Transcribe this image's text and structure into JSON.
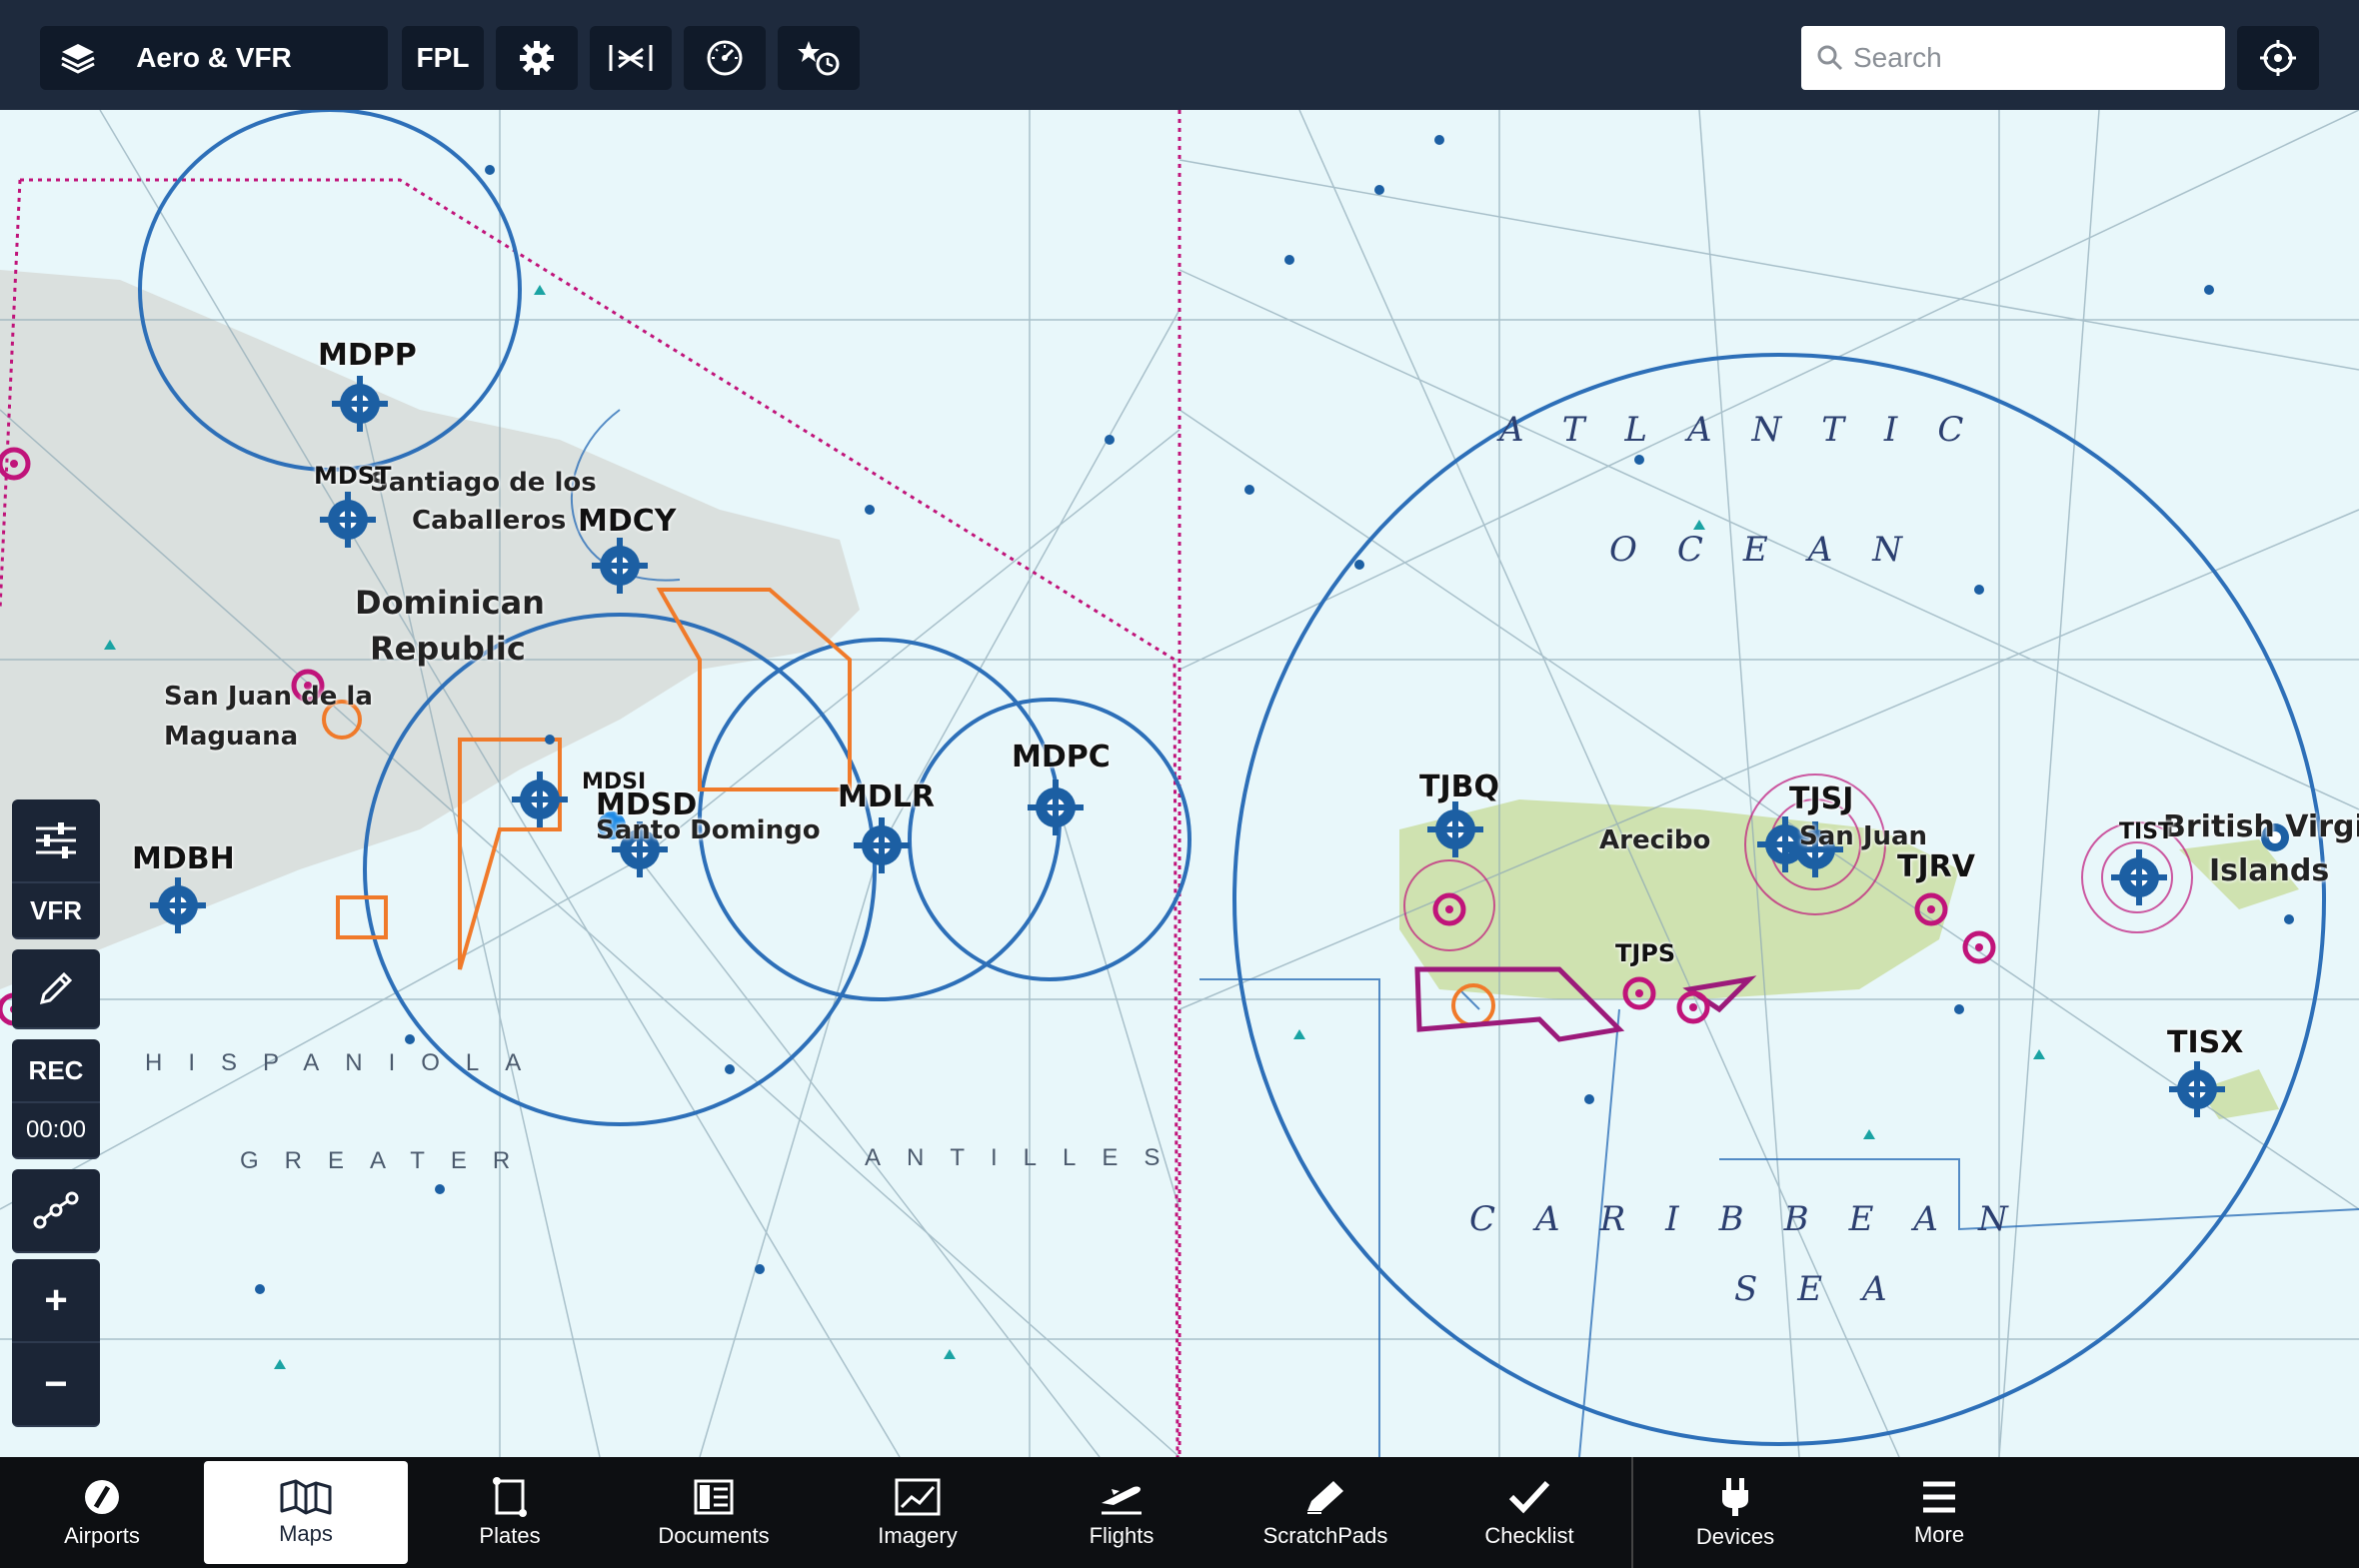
{
  "toolbar": {
    "layers_label": "Aero & VFR",
    "fpl_label": "FPL",
    "search_placeholder": "Search"
  },
  "map": {
    "airports": [
      "MDPP",
      "MDST",
      "MDCY",
      "MDSD",
      "MDSI",
      "MDLR",
      "MDPC",
      "MDBH",
      "TJBQ",
      "TJSJ",
      "TJRV",
      "TJPS",
      "TIST",
      "TISX"
    ],
    "places": {
      "dominican_1": "Dominican",
      "dominican_2": "Republic",
      "santiago_1": "Santiago de los",
      "santiago_2": "Caballeros",
      "sanjuan_mag_1": "San Juan de la",
      "sanjuan_mag_2": "Maguana",
      "santo_domingo": "Santo Domingo",
      "arecibo": "Arecibo",
      "san_juan": "San Juan",
      "bvi_1": "British Virgin",
      "bvi_2": "Islands"
    },
    "ocean": {
      "atlantic": "ATLANTIC",
      "ocean": "OCEAN",
      "caribbean": "CARIBBEAN",
      "sea": "SEA",
      "hispaniola": "HISPANIOLA",
      "greater": "GREATER",
      "antilles": "ANTILLES"
    }
  },
  "sidebar": {
    "vfr_label": "VFR",
    "rec_label": "REC",
    "timer": "00:00",
    "zoom_in": "+",
    "zoom_out": "−"
  },
  "tabs": [
    {
      "label": "Airports",
      "icon": "compass-icon"
    },
    {
      "label": "Maps",
      "icon": "map-icon",
      "selected": true
    },
    {
      "label": "Plates",
      "icon": "plate-icon"
    },
    {
      "label": "Documents",
      "icon": "documents-icon"
    },
    {
      "label": "Imagery",
      "icon": "imagery-icon"
    },
    {
      "label": "Flights",
      "icon": "plane-icon"
    },
    {
      "label": "ScratchPads",
      "icon": "pencil-icon"
    },
    {
      "label": "Checklist",
      "icon": "checkmark-icon"
    },
    {
      "label": "Devices",
      "icon": "plug-icon"
    },
    {
      "label": "More",
      "icon": "menu-icon"
    }
  ],
  "colors": {
    "toolbar": "#1e2a3d",
    "chart_water": "#e8f7fa",
    "airspace_blue": "#2d6fb8",
    "boundary_magenta": "#c0147a",
    "restricted_orange": "#f07a2a"
  }
}
